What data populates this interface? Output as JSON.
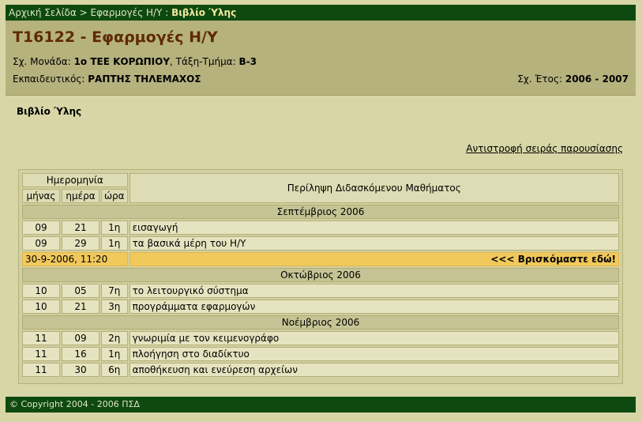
{
  "breadcrumb": {
    "home": "Αρχική Σελίδα",
    "sep1": ">",
    "section": "Εφαρμογές Η/Υ",
    "sep2": ":",
    "current": "Βιβλίο Ύλης"
  },
  "header": {
    "course_title": "T16122 - Εφαρμογές Η/Υ",
    "school_label": "Σχ. Μονάδα:",
    "school_value": "1ο ΤΕΕ ΚΟΡΩΠΙΟΥ",
    "class_label": "Τάξη-Τμήμα:",
    "class_value": "Β-3",
    "teacher_label": "Εκπαιδευτικός:",
    "teacher_value": "ΡΑΠΤΗΣ ΤΗΛΕΜΑΧΟΣ",
    "year_label": "Σχ. Έτος:",
    "year_value": "2006 - 2007"
  },
  "page_heading": "Βιβλίο Ύλης",
  "reverse_link": "Αντιστροφή σειράς παρουσίασης",
  "table": {
    "date_header": "Ημερομηνία",
    "col_month": "μήνας",
    "col_day": "ημέρα",
    "col_hour": "ώρα",
    "col_summary": "Περίληψη Διδασκόμενου Μαθήματος",
    "groups": [
      {
        "month": "Σεπτέμβριος 2006",
        "rows": [
          {
            "m": "09",
            "d": "21",
            "h": "1η",
            "text": "εισαγωγή"
          },
          {
            "m": "09",
            "d": "29",
            "h": "1η",
            "text": "τα βασικά μέρη του Η/Υ"
          }
        ]
      },
      {
        "month": "Οκτώβριος 2006",
        "rows": [
          {
            "m": "10",
            "d": "05",
            "h": "7η",
            "text": "το λειτουργικό σύστημα"
          },
          {
            "m": "10",
            "d": "21",
            "h": "3η",
            "text": "προγράμματα εφαρμογών"
          }
        ]
      },
      {
        "month": "Νοέμβριος 2006",
        "rows": [
          {
            "m": "11",
            "d": "09",
            "h": "2η",
            "text": "γνωριμία με τον κειμενογράφο"
          },
          {
            "m": "11",
            "d": "16",
            "h": "1η",
            "text": "πλοήγηση στο διαδίκτυο"
          },
          {
            "m": "11",
            "d": "30",
            "h": "6η",
            "text": "αποθήκευση και ενεύρεση αρχείων"
          }
        ]
      }
    ],
    "now_row": {
      "date": "30-9-2006, 11:20",
      "message": "<<< Βρισκόμαστε εδώ!"
    }
  },
  "footer": "© Copyright 2004 - 2006 ΠΣΔ",
  "colors": {
    "bar_green": "#0e4a10",
    "header_olive": "#b6b27e",
    "title_brown": "#5e2a06",
    "now_highlight": "#f0c85c"
  }
}
